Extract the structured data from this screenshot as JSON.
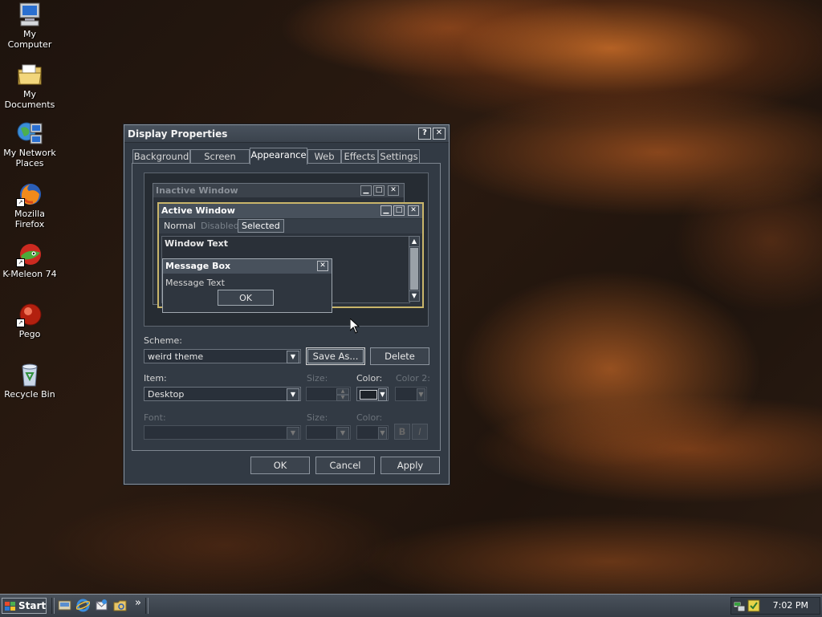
{
  "desktop": {
    "icons": [
      {
        "label": "My Computer",
        "icon": "computer-icon"
      },
      {
        "label": "My Documents",
        "icon": "folder-icon"
      },
      {
        "label": "My Network Places",
        "icon": "network-icon"
      },
      {
        "label": "Mozilla Firefox",
        "icon": "firefox-icon"
      },
      {
        "label": "K-Meleon 74",
        "icon": "kmeleon-icon"
      },
      {
        "label": "Pego",
        "icon": "pego-icon"
      },
      {
        "label": "Recycle Bin",
        "icon": "recycle-bin-icon"
      }
    ]
  },
  "dialog": {
    "title": "Display Properties",
    "help_glyph": "?",
    "close_glyph": "✕",
    "tabs": [
      "Background",
      "Screen Saver",
      "Appearance",
      "Web",
      "Effects",
      "Settings"
    ],
    "active_tab": "Appearance",
    "preview": {
      "inactive_title": "Inactive Window",
      "active_title": "Active Window",
      "menu": [
        "Normal",
        "Disabled",
        "Selected"
      ],
      "window_text": "Window Text",
      "msgbox_title": "Message Box",
      "msgbox_text": "Message Text",
      "ok": "OK"
    },
    "scheme_label": "Scheme:",
    "scheme_value": "weird theme",
    "save_as": "Save As...",
    "delete": "Delete",
    "item_label": "Item:",
    "item_value": "Desktop",
    "size_label": "Size:",
    "color_label": "Color:",
    "color2_label": "Color 2:",
    "font_label": "Font:",
    "font_size_label": "Size:",
    "font_color_label": "Color:",
    "bold": "B",
    "italic": "I",
    "ok": "OK",
    "cancel": "Cancel",
    "apply": "Apply"
  },
  "taskbar": {
    "start": "Start",
    "quicklaunch": [
      "show-desktop-icon",
      "ie-icon",
      "outlook-icon",
      "explorer-icon"
    ],
    "chevron": "»",
    "clock": "7:02 PM"
  }
}
